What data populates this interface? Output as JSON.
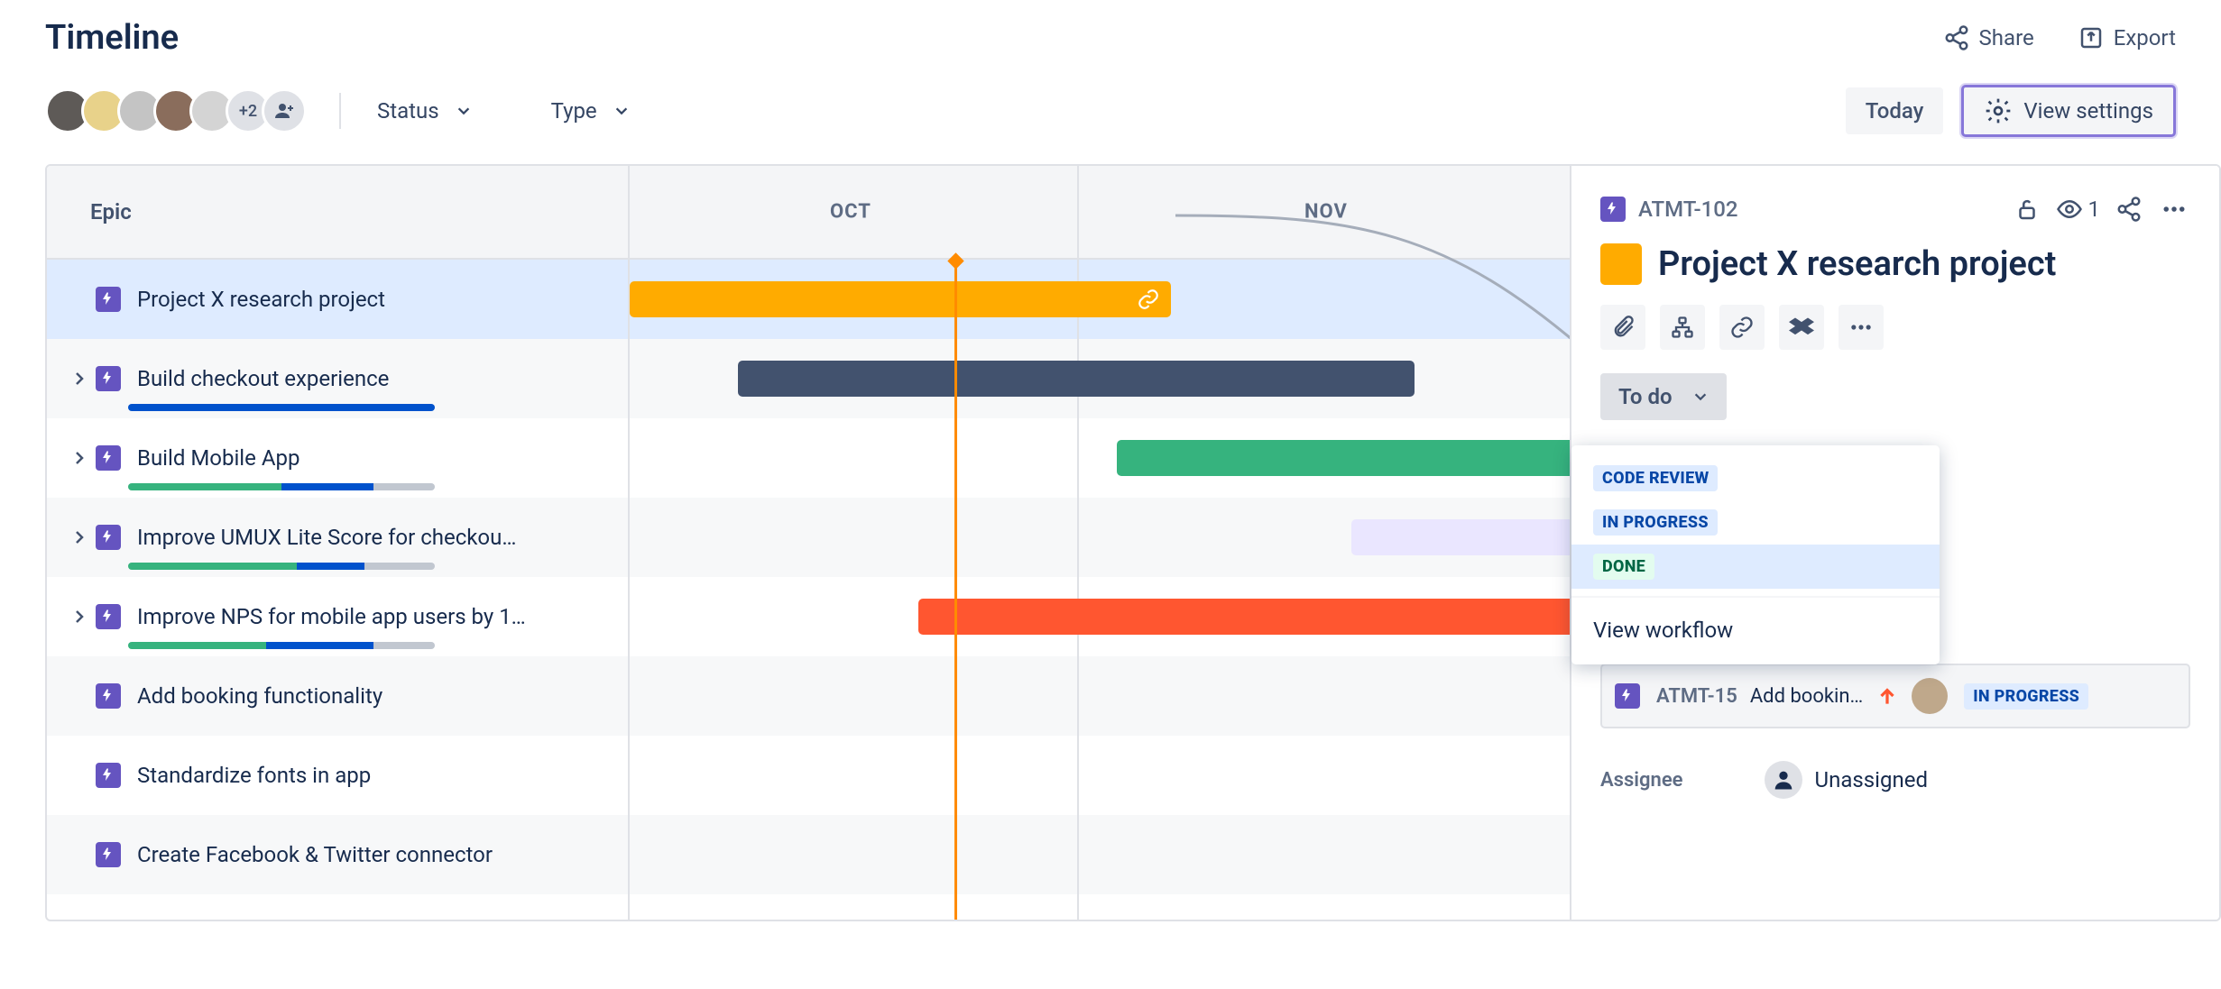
{
  "header": {
    "title": "Timeline",
    "share": "Share",
    "export": "Export"
  },
  "toolbar": {
    "avatarMore": "+2",
    "statusFilter": "Status",
    "typeFilter": "Type",
    "today": "Today",
    "viewSettings": "View settings"
  },
  "columns": {
    "epic": "Epic"
  },
  "months": {
    "oct": "OCT",
    "nov": "NOV"
  },
  "epics": [
    {
      "name": "Project X research project"
    },
    {
      "name": "Build checkout experience"
    },
    {
      "name": "Build Mobile App"
    },
    {
      "name": "Improve UMUX Lite Score for checkou…"
    },
    {
      "name": "Improve NPS for mobile app users by 1…"
    },
    {
      "name": "Add booking functionality"
    },
    {
      "name": "Standardize fonts in app"
    },
    {
      "name": "Create Facebook & Twitter connector"
    }
  ],
  "detail": {
    "key": "ATMT-102",
    "watchers": "1",
    "title": "Project X research project",
    "status": "To do",
    "options": {
      "codeReview": "CODE REVIEW",
      "inProgress": "IN PROGRESS",
      "done": "DONE"
    },
    "viewWorkflow": "View workflow",
    "child": {
      "key": "ATMT-15",
      "summary": "Add bookin…",
      "status": "IN PROGRESS"
    },
    "assigneeLabel": "Assignee",
    "assigneeValue": "Unassigned"
  }
}
